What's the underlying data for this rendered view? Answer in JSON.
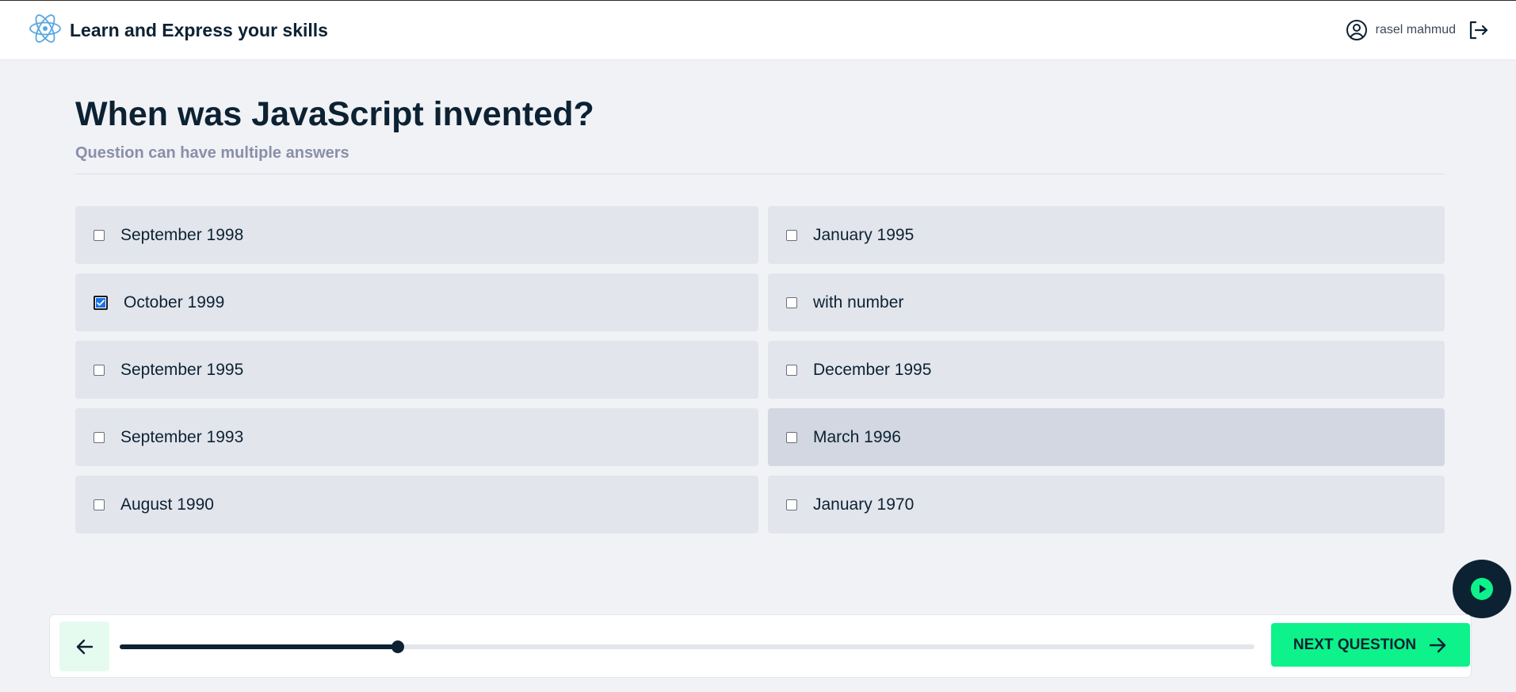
{
  "app": {
    "title": "Learn and Express your skills"
  },
  "user": {
    "name": "rasel mahmud"
  },
  "question": {
    "title": "When was JavaScript invented?",
    "subtitle": "Question can have multiple answers"
  },
  "answers": [
    {
      "label": "September 1998",
      "checked": false
    },
    {
      "label": "January 1995",
      "checked": false
    },
    {
      "label": "October 1999",
      "checked": true
    },
    {
      "label": "with number",
      "checked": false
    },
    {
      "label": "September 1995",
      "checked": false
    },
    {
      "label": "December 1995",
      "checked": false
    },
    {
      "label": "September 1993",
      "checked": false
    },
    {
      "label": "March 1996",
      "checked": false
    },
    {
      "label": "August 1990",
      "checked": false
    },
    {
      "label": "January 1970",
      "checked": false
    }
  ],
  "footer": {
    "next_label": "NEXT QUESTION",
    "progress_percent": 24.5
  },
  "icons": {
    "logo": "react-atom-icon",
    "user": "user-circle-icon",
    "logout": "logout-icon",
    "back": "arrow-left-icon",
    "next": "arrow-right-icon",
    "play": "play-circle-icon"
  },
  "colors": {
    "accent": "#0df28a",
    "dark": "#0c2233",
    "checked": "#1a73e8",
    "logo": "#5aa7e0"
  }
}
